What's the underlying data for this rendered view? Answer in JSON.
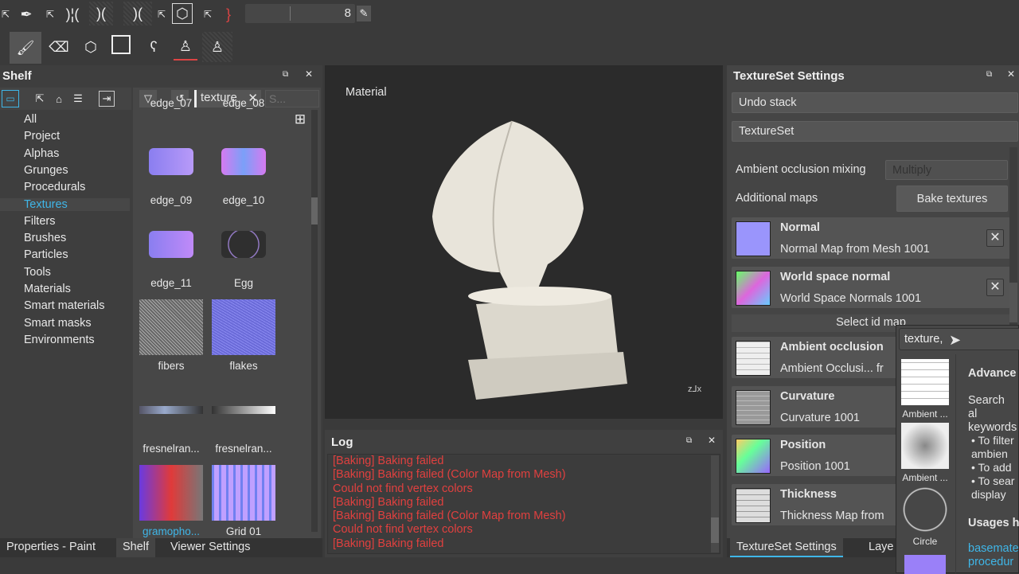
{
  "toolbar": {
    "brush_size_value": "8",
    "icons_row1": [
      "external-link-icon",
      "pen-icon",
      "external-link-icon",
      "symmetry-icon",
      "symmetry-x-icon",
      "symmetry-y-icon",
      "external-link-icon",
      "cube-icon",
      "external-link-icon",
      "lazy-mouse-icon",
      "pencil-icon"
    ],
    "icons_row2": [
      "paint-brush-icon",
      "eraser-icon",
      "projection-icon",
      "polygon-fill-icon",
      "smudge-icon",
      "clone-stamp-icon",
      "material-picker-icon"
    ]
  },
  "shelf": {
    "title": "Shelf",
    "categories": [
      "All",
      "Project",
      "Alphas",
      "Grunges",
      "Procedurals",
      "Textures",
      "Filters",
      "Brushes",
      "Particles",
      "Tools",
      "Materials",
      "Smart materials",
      "Smart masks",
      "Environments"
    ],
    "selected_category": "Textures",
    "filter_tag": "texture",
    "search_placeholder": "S...",
    "items": [
      "edge_07",
      "edge_08",
      "edge_09",
      "edge_10",
      "edge_11",
      "Egg",
      "fibers",
      "flakes",
      "fresnelran...",
      "fresnelran...",
      "gramopho...",
      "Grid 01"
    ]
  },
  "viewport": {
    "label": "Material"
  },
  "log": {
    "title": "Log",
    "lines": [
      "[Baking] Baking failed",
      "[Baking] Baking failed (Color Map from Mesh)",
      "Could not find vertex colors",
      "[Baking] Baking failed",
      "[Baking] Baking failed (Color Map from Mesh)",
      "Could not find vertex colors",
      "[Baking] Baking failed"
    ]
  },
  "bottom_tabs_left": [
    "Properties - Paint",
    "Shelf",
    "Viewer Settings"
  ],
  "active_bottom_tab_left": "Shelf",
  "textureset": {
    "title": "TextureSet Settings",
    "undo_stack": "Undo stack",
    "textureset_label": "TextureSet",
    "ao_mixing_label": "Ambient occlusion mixing",
    "ao_mixing_value": "Multiply",
    "additional_maps_label": "Additional maps",
    "bake_button": "Bake textures",
    "select_id_map": "Select id map",
    "maps": [
      {
        "title": "Normal",
        "sub": "Normal Map from Mesh 1001"
      },
      {
        "title": "World space normal",
        "sub": "World Space Normals 1001"
      },
      {
        "title": "Ambient occlusion",
        "sub": "Ambient Occlusi... fr"
      },
      {
        "title": "Curvature",
        "sub": "Curvature 1001"
      },
      {
        "title": "Position",
        "sub": "Position 1001"
      },
      {
        "title": "Thickness",
        "sub": "Thickness Map from"
      }
    ]
  },
  "bottom_tabs_right": [
    "TextureSet Settings",
    "Laye"
  ],
  "popup": {
    "search_value": "texture, ",
    "items": [
      "Ambient ...",
      "Ambient ...",
      "Circle"
    ],
    "help_title": "Advance",
    "help_text": "Search al keywords",
    "bullets": [
      "To filter ambien",
      "To add",
      "To sear display"
    ],
    "usages_title": "Usages h",
    "links": [
      "basemate",
      "procedur"
    ]
  },
  "colors": {
    "accent": "#3fb6e8",
    "error": "#e0403f",
    "panel": "#444444",
    "viewport": "#2b2b2b"
  }
}
